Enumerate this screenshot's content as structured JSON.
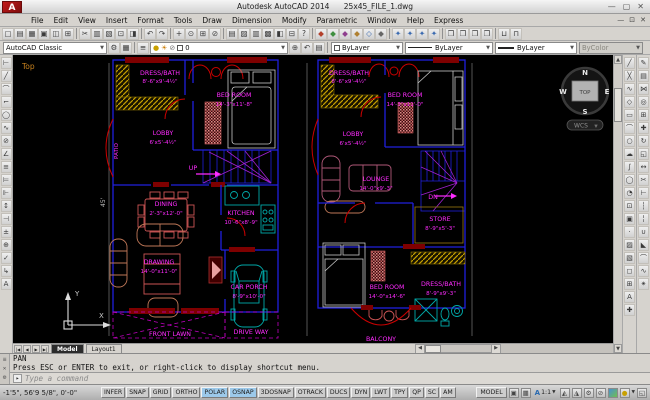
{
  "window": {
    "app_title": "Autodesk AutoCAD 2014",
    "doc_title": "25x45_FILE_1.dwg"
  },
  "menu": {
    "items": [
      "File",
      "Edit",
      "View",
      "Insert",
      "Format",
      "Tools",
      "Draw",
      "Dimension",
      "Modify",
      "Parametric",
      "Window",
      "Help",
      "Express"
    ]
  },
  "toolbars": {
    "standard": [
      {
        "name": "qnew-icon",
        "g": "▢"
      },
      {
        "name": "open-icon",
        "g": "▤"
      },
      {
        "name": "save-icon",
        "g": "▦"
      },
      {
        "name": "plot-icon",
        "g": "▣"
      },
      {
        "name": "plot-preview-icon",
        "g": "◫"
      },
      {
        "name": "publish-icon",
        "g": "⊞"
      },
      {
        "sep": true
      },
      {
        "name": "cut-icon",
        "g": "✂"
      },
      {
        "name": "copy-clip-icon",
        "g": "▥"
      },
      {
        "name": "paste-icon",
        "g": "▧"
      },
      {
        "name": "match-properties-icon",
        "g": "⊡"
      },
      {
        "name": "block-editor-icon",
        "g": "◨"
      },
      {
        "sep": true
      },
      {
        "name": "undo-icon",
        "g": "↶"
      },
      {
        "name": "redo-icon",
        "g": "↷"
      },
      {
        "sep": true
      },
      {
        "name": "pan-icon",
        "g": "+"
      },
      {
        "name": "zoom-realtime-icon",
        "g": "⊙"
      },
      {
        "name": "zoom-window-icon",
        "g": "⊞"
      },
      {
        "name": "zoom-previous-icon",
        "g": "⊘"
      },
      {
        "sep": true
      },
      {
        "name": "properties-icon",
        "g": "▤"
      },
      {
        "name": "design-center-icon",
        "g": "▨"
      },
      {
        "name": "tool-palettes-icon",
        "g": "▥"
      },
      {
        "name": "sheet-set-manager-icon",
        "g": "▩"
      },
      {
        "name": "markup-icon",
        "g": "◧"
      },
      {
        "name": "quickcalc-icon",
        "g": "⊟"
      },
      {
        "name": "help-icon",
        "g": "?"
      },
      {
        "sep": true
      },
      {
        "name": "render-icon",
        "g": "◆",
        "c": "#b3402a"
      },
      {
        "name": "lights-icon",
        "g": "◆",
        "c": "#3f8f3f"
      },
      {
        "name": "materials-icon",
        "g": "◆",
        "c": "#8f3f8f"
      },
      {
        "name": "materials-browser-icon",
        "g": "◆",
        "c": "#b08030"
      },
      {
        "name": "mapping-icon",
        "g": "◇",
        "c": "#3a6ab0"
      },
      {
        "name": "render-environment-icon",
        "g": "◆",
        "c": "#666666"
      },
      {
        "sep": true
      },
      {
        "name": "orbit-icon",
        "g": "✦",
        "c": "#3a6ab0"
      },
      {
        "name": "free-orbit-icon",
        "g": "✦",
        "c": "#3a6ab0"
      },
      {
        "name": "continuous-orbit-icon",
        "g": "✦",
        "c": "#3a6ab0"
      },
      {
        "name": "swivel-icon",
        "g": "✦",
        "c": "#3a6ab0"
      },
      {
        "sep": true
      },
      {
        "name": "workspace-icon-1",
        "g": "❒"
      },
      {
        "name": "workspace-icon-2",
        "g": "❒"
      },
      {
        "name": "workspace-icon-3",
        "g": "❒"
      },
      {
        "name": "workspace-icon-4",
        "g": "❒"
      },
      {
        "sep": true
      },
      {
        "name": "etransmit-icon",
        "g": "⊔"
      },
      {
        "name": "hyperlink-icon",
        "g": "⊓"
      }
    ],
    "left": [
      {
        "name": "linear-dimension-icon",
        "g": "⊢"
      },
      {
        "name": "aligned-dimension-icon",
        "g": "╱"
      },
      {
        "name": "arc-length-icon",
        "g": "⌒"
      },
      {
        "name": "ordinate-icon",
        "g": "⌐"
      },
      {
        "name": "radius-icon",
        "g": "◯"
      },
      {
        "name": "jogged-icon",
        "g": "∿"
      },
      {
        "name": "diameter-icon",
        "g": "⊘"
      },
      {
        "name": "angular-icon",
        "g": "∠"
      },
      {
        "name": "quick-dimension-icon",
        "g": "≡"
      },
      {
        "name": "baseline-icon",
        "g": "⊨"
      },
      {
        "name": "continue-icon",
        "g": "⊩"
      },
      {
        "name": "dimension-space-icon",
        "g": "↕"
      },
      {
        "name": "dimension-break-icon",
        "g": "⊣"
      },
      {
        "name": "tolerance-icon",
        "g": "±"
      },
      {
        "name": "center-mark-icon",
        "g": "⊕"
      },
      {
        "name": "inspect-icon",
        "g": "✓"
      },
      {
        "name": "jog-line-icon",
        "g": "↳"
      },
      {
        "name": "dimension-edit-icon",
        "g": "A"
      }
    ],
    "draw": [
      {
        "name": "line-icon",
        "g": "╱"
      },
      {
        "name": "construction-line-icon",
        "g": "╳"
      },
      {
        "name": "polyline-icon",
        "g": "∿"
      },
      {
        "name": "polygon-icon",
        "g": "◇"
      },
      {
        "name": "rectangle-icon",
        "g": "▭"
      },
      {
        "name": "arc-icon",
        "g": "⌒"
      },
      {
        "name": "circle-icon",
        "g": "○"
      },
      {
        "name": "revision-cloud-icon",
        "g": "☁"
      },
      {
        "name": "spline-icon",
        "g": "∫"
      },
      {
        "name": "ellipse-icon",
        "g": "◯"
      },
      {
        "name": "ellipse-arc-icon",
        "g": "◔"
      },
      {
        "name": "insert-block-icon",
        "g": "⊡"
      },
      {
        "name": "make-block-icon",
        "g": "▣"
      },
      {
        "name": "point-icon",
        "g": "·"
      },
      {
        "name": "hatch-icon",
        "g": "▨"
      },
      {
        "name": "gradient-icon",
        "g": "▧"
      },
      {
        "name": "region-icon",
        "g": "◻"
      },
      {
        "name": "table-icon",
        "g": "⊞"
      },
      {
        "name": "multiline-text-icon",
        "g": "A"
      },
      {
        "name": "add-selected-icon",
        "g": "✚"
      }
    ],
    "modify": [
      {
        "name": "erase-icon",
        "g": "✎"
      },
      {
        "name": "copy-icon",
        "g": "▤"
      },
      {
        "name": "mirror-icon",
        "g": "⋈"
      },
      {
        "name": "offset-icon",
        "g": "◎"
      },
      {
        "name": "array-icon",
        "g": "⊞"
      },
      {
        "name": "move-icon",
        "g": "✚"
      },
      {
        "name": "rotate-icon",
        "g": "↻"
      },
      {
        "name": "scale-icon",
        "g": "◱"
      },
      {
        "name": "stretch-icon",
        "g": "↔"
      },
      {
        "name": "trim-icon",
        "g": "✂"
      },
      {
        "name": "extend-icon",
        "g": "⊢"
      },
      {
        "name": "break-at-point-icon",
        "g": "┆"
      },
      {
        "name": "break-icon",
        "g": "╎"
      },
      {
        "name": "join-icon",
        "g": "∪"
      },
      {
        "name": "chamfer-icon",
        "g": "◣"
      },
      {
        "name": "fillet-icon",
        "g": "⌒"
      },
      {
        "name": "blend-curves-icon",
        "g": "∿"
      },
      {
        "name": "explode-icon",
        "g": "✴"
      }
    ]
  },
  "workspace": {
    "selected": "AutoCAD Classic"
  },
  "layer": {
    "current": "0"
  },
  "properties": {
    "color": "ByLayer",
    "linetype": "ByLayer",
    "lineweight": "ByLayer",
    "plot_style": "ByColor"
  },
  "canvas": {
    "view_label": "Top",
    "plot_depth_dim": "45'",
    "viewcube": {
      "n": "N",
      "e": "E",
      "s": "S",
      "w": "W",
      "top": "TOP",
      "wcs": "WCS"
    },
    "ucs": {
      "x": "X",
      "y": "Y"
    }
  },
  "plans": {
    "left": {
      "rooms": [
        {
          "name": "DRESS/BATH",
          "dims": "8'-6\"x9'-4½\""
        },
        {
          "name": "BED ROOM",
          "dims": "14'-3\"x11'-8\""
        },
        {
          "name": "LOBBY",
          "dims": "6'x5'-4½\""
        },
        {
          "name": "PATIO"
        },
        {
          "name": "UP"
        },
        {
          "name": "DINING",
          "dims": "2'-3\"x12'-0\""
        },
        {
          "name": "KITCHEN",
          "dims": "10'-6\"x8'-9\""
        },
        {
          "name": "DRAWING",
          "dims": "14'-0\"x11'-0\""
        },
        {
          "name": "CAR PORCH",
          "dims": "8'-9\"x10'-0\""
        },
        {
          "name": "FRONT LAWN"
        },
        {
          "name": "DRIVE WAY"
        }
      ]
    },
    "right": {
      "rooms": [
        {
          "name": "DRESS/BATH",
          "dims": "8'-6\"x9'-4½\""
        },
        {
          "name": "BED ROOM",
          "dims": "14'-3\"x11'-0\""
        },
        {
          "name": "LOBBY",
          "dims": "6'x5'-4½\""
        },
        {
          "name": "LOUNGE",
          "dims": "14'-0\"x9'-3\""
        },
        {
          "name": "DN"
        },
        {
          "name": "STORE",
          "dims": "8'-9\"x5'-3\""
        },
        {
          "name": "BED ROOM",
          "dims": "14'-0\"x14'-6\""
        },
        {
          "name": "DRESS/BATH",
          "dims": "8'-9\"x9'-3\""
        },
        {
          "name": "BALCONY"
        }
      ]
    }
  },
  "tabs": {
    "nav": [
      "|◀",
      "◀",
      "▶",
      "▶|"
    ],
    "model": "Model",
    "layout": "Layout1"
  },
  "command": {
    "history": [
      "PAN",
      "Press ESC or ENTER to exit, or right-click to display shortcut menu."
    ],
    "placeholder": "Type a command"
  },
  "status": {
    "coords": "-1'5\", 56'9 5/8\", 0'-0\"",
    "toggles": [
      {
        "label": "INFER",
        "active": false
      },
      {
        "label": "SNAP",
        "active": false
      },
      {
        "label": "GRID",
        "active": false
      },
      {
        "label": "ORTHO",
        "active": false
      },
      {
        "label": "POLAR",
        "active": true
      },
      {
        "label": "OSNAP",
        "active": true
      },
      {
        "label": "3DOSNAP",
        "active": false
      },
      {
        "label": "OTRACK",
        "active": false
      },
      {
        "label": "DUCS",
        "active": false
      },
      {
        "label": "DYN",
        "active": false
      },
      {
        "label": "LWT",
        "active": false
      },
      {
        "label": "TPY",
        "active": false
      },
      {
        "label": "QP",
        "active": false
      },
      {
        "label": "SC",
        "active": false
      },
      {
        "label": "AM",
        "active": false
      }
    ],
    "model_label": "MODEL",
    "annotation_scale": "1:1"
  },
  "colors": {
    "wall_blue": "#2020dd",
    "label_magenta": "#ff2bff",
    "wall_maroon": "#7e0000",
    "hatch_yellow": "#c8a100",
    "fixture_teal": "#00a8a8",
    "furniture_brown": "#c07858",
    "stair_purple": "#a020d0",
    "boundary_purple": "#c000c0",
    "toggle_active": "#9cc9ea"
  }
}
